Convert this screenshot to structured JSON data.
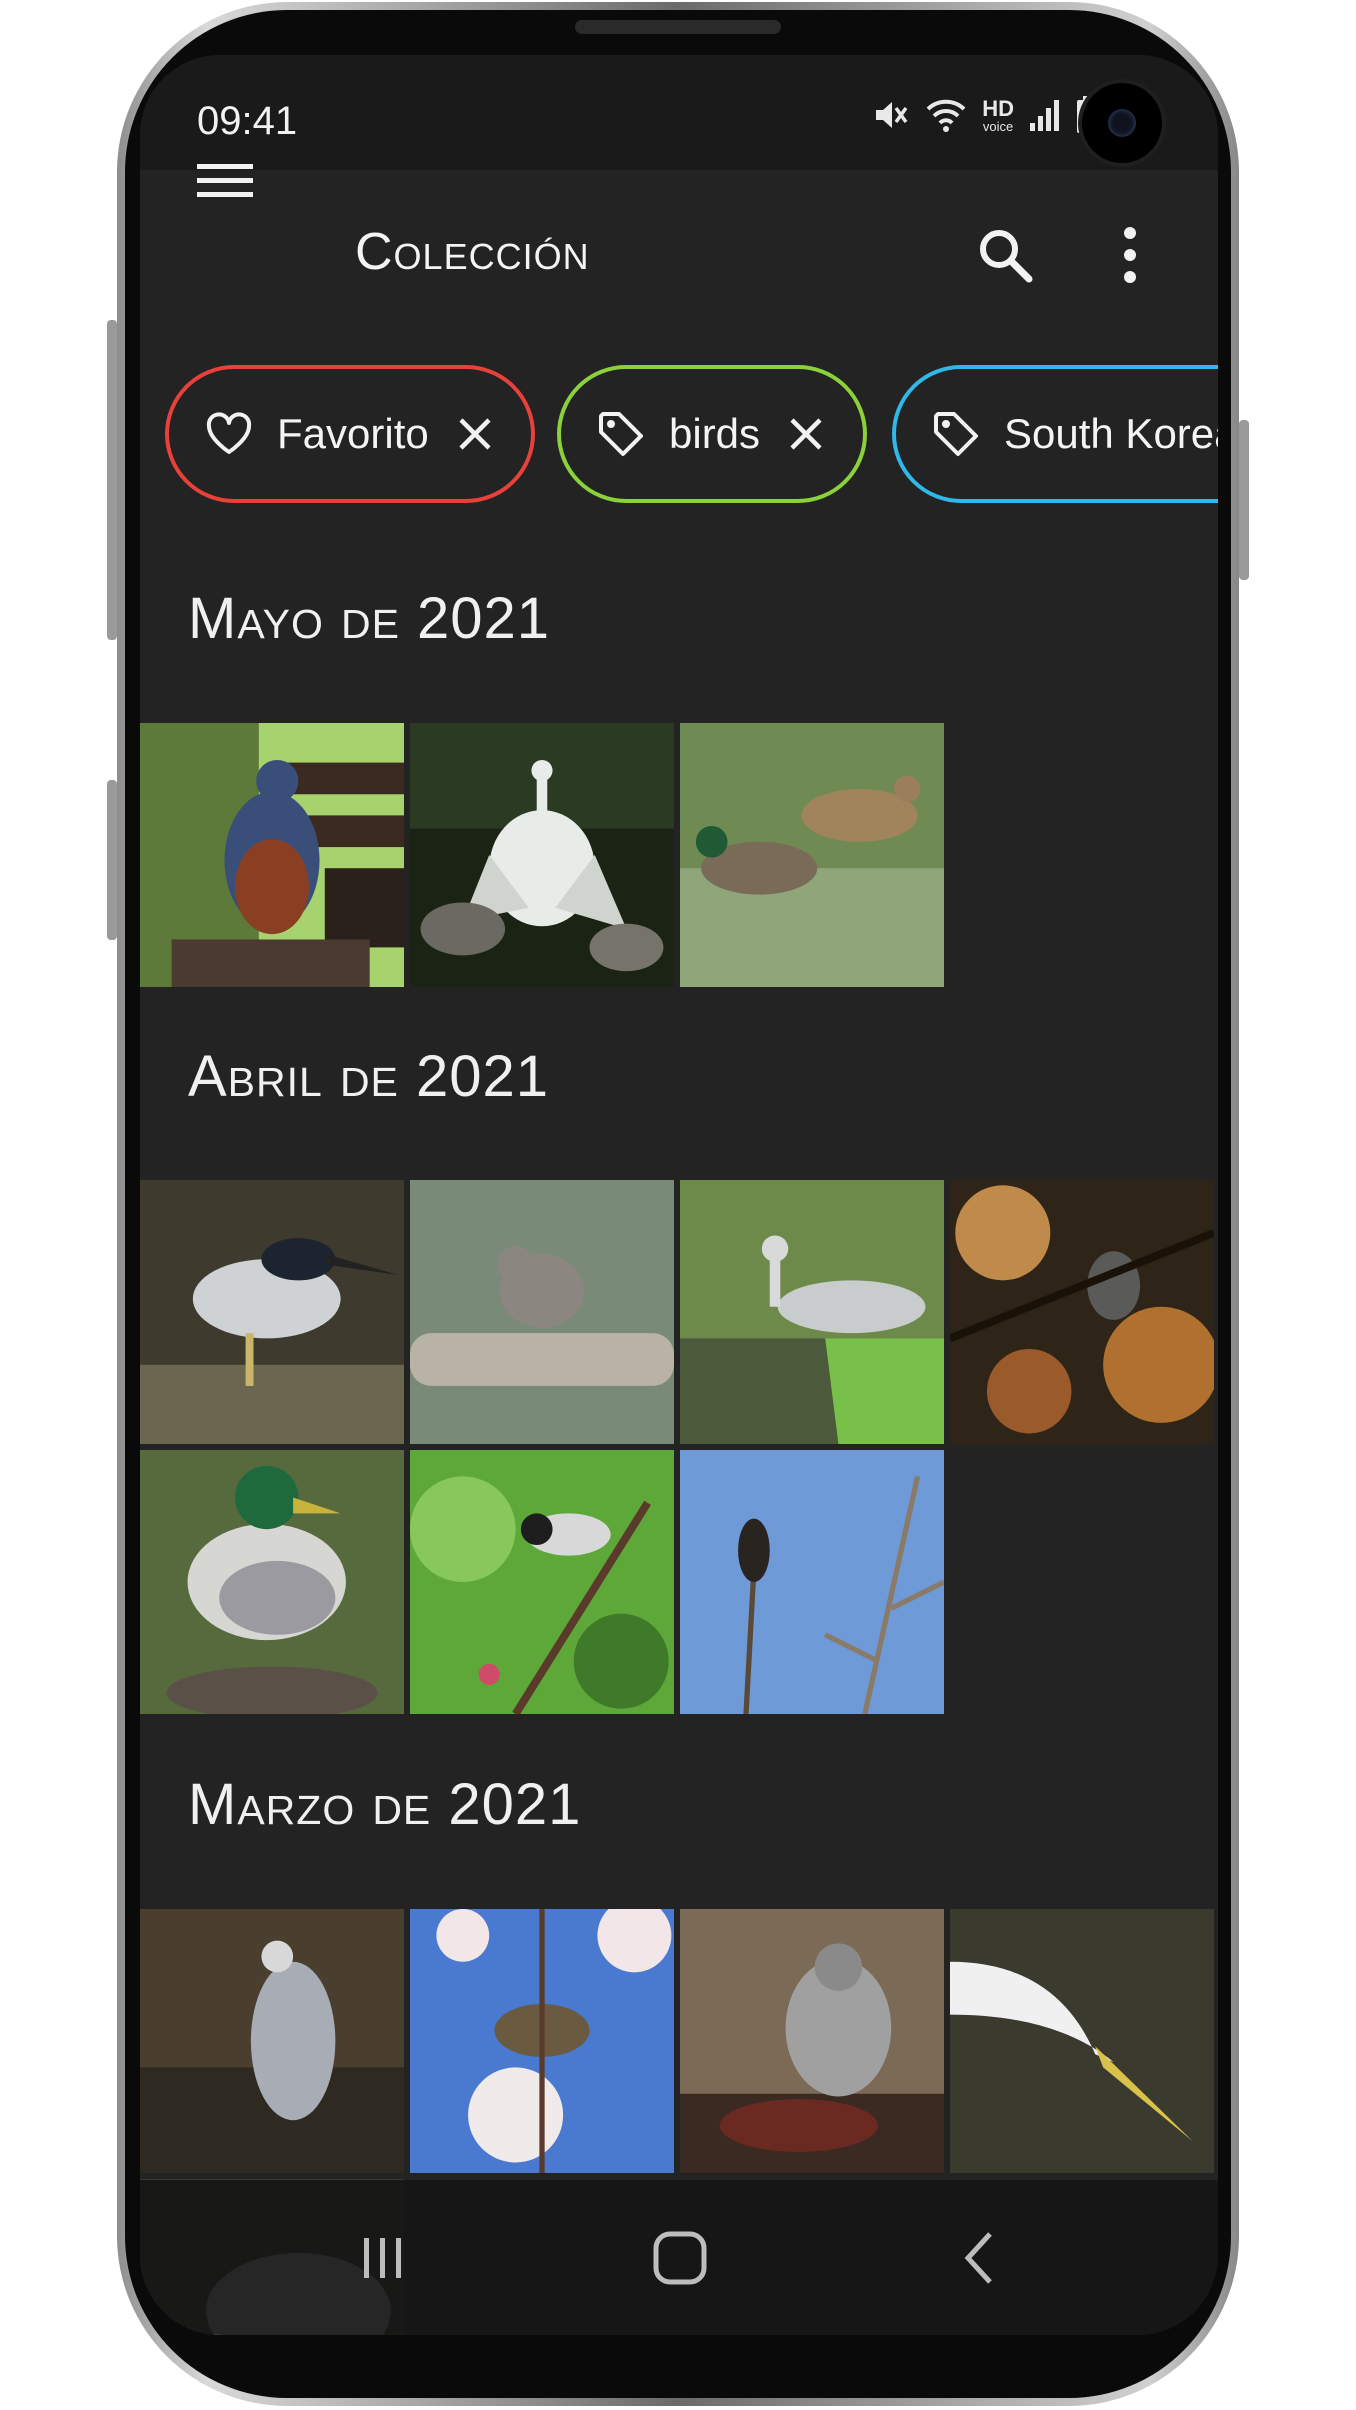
{
  "status_bar": {
    "time": "09:41",
    "hd_label": "HD",
    "voice_label": "voice"
  },
  "app_bar": {
    "title": "Colección"
  },
  "icons": {
    "menu": "menu-icon",
    "search": "search-icon",
    "more": "more-vert-icon",
    "favorite": "heart-icon",
    "tag": "tag-icon",
    "close": "close-icon",
    "nav_recents": "recents-icon",
    "nav_home": "home-icon",
    "nav_back": "back-icon"
  },
  "filters": [
    {
      "label": "Favorito",
      "icon": "heart-icon",
      "color": "#e8413a"
    },
    {
      "label": "birds",
      "icon": "tag-icon",
      "color": "#8bd13a"
    },
    {
      "label": "South Korea",
      "icon": "tag-icon",
      "color": "#2fb8e8"
    }
  ],
  "sections": [
    {
      "title": "Mayo de 2021",
      "photo_count": 3
    },
    {
      "title": "Abril de 2021",
      "photo_count": 7
    },
    {
      "title": "Marzo de 2021",
      "photo_count": 5
    }
  ],
  "colors": {
    "screen_bg": "#232323",
    "status_bg": "#1a1a1a",
    "text": "#f2f2f2"
  }
}
